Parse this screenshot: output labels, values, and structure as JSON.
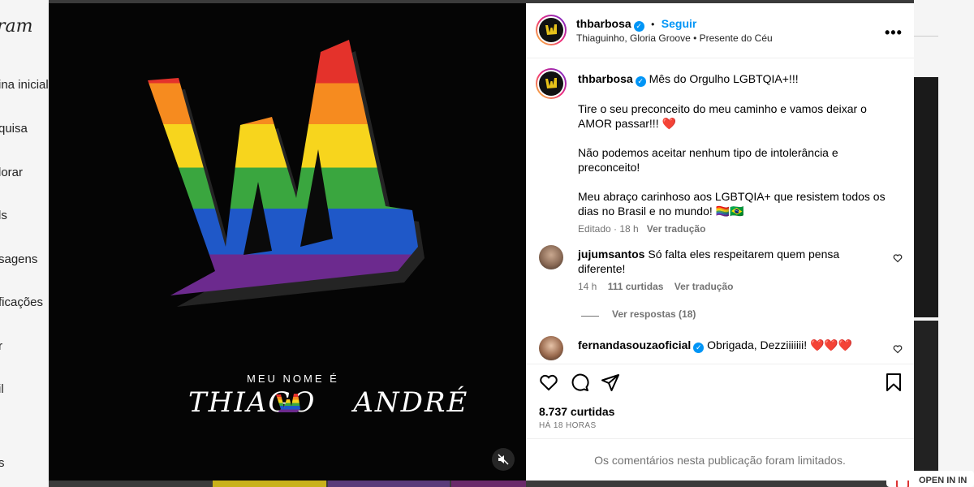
{
  "background": {
    "logo": "ram",
    "nav": [
      "ina inicial",
      "quisa",
      "lorar",
      "ls",
      "sagens",
      "ficações",
      "r",
      "il",
      "s"
    ],
    "open_in": "OPEN IN IN"
  },
  "media": {
    "caption_top": "MEU NOME É",
    "caption_left": "THIAGO",
    "caption_right": "ANDRÉ",
    "mute_icon": "speaker-muted-icon"
  },
  "header": {
    "username": "thbarbosa",
    "separator": "•",
    "follow": "Seguir",
    "audio": "Thiaguinho, Gloria Groove • Presente do Céu",
    "more": "•••"
  },
  "caption": {
    "username": "thbarbosa",
    "title": "Mês do Orgulho LGBTQIA+!!!",
    "para1": "Tire o seu preconceito do meu caminho e vamos deixar o AMOR passar!!! ❤️",
    "para2": "Não podemos aceitar nenhum tipo de intolerância e preconceito!",
    "para3": "Meu abraço carinhoso aos LGBTQIA+ que resistem todos os dias no Brasil e no mundo! 🏳️‍🌈🇧🇷",
    "edited": "Editado · 18 h",
    "translate": "Ver tradução"
  },
  "comments": [
    {
      "username": "jujumsantos",
      "text": "Só falta eles respeitarem quem pensa diferente!",
      "time": "14 h",
      "likes": "111 curtidas",
      "translate": "Ver tradução",
      "replies": "Ver respostas (18)"
    },
    {
      "username": "fernandasouzaoficial",
      "text": "Obrigada, Dezziiiiiii! ❤️❤️❤️"
    }
  ],
  "actions": {
    "likes": "8.737 curtidas",
    "time": "HÁ 18 HORAS"
  },
  "footer": {
    "limited": "Os comentários nesta publicação foram limitados."
  },
  "colors": {
    "accent": "#0095f6",
    "rainbow": [
      "#e4322b",
      "#f68b1f",
      "#f7d51d",
      "#3aa63f",
      "#1f58c8",
      "#6c2a8e"
    ]
  }
}
